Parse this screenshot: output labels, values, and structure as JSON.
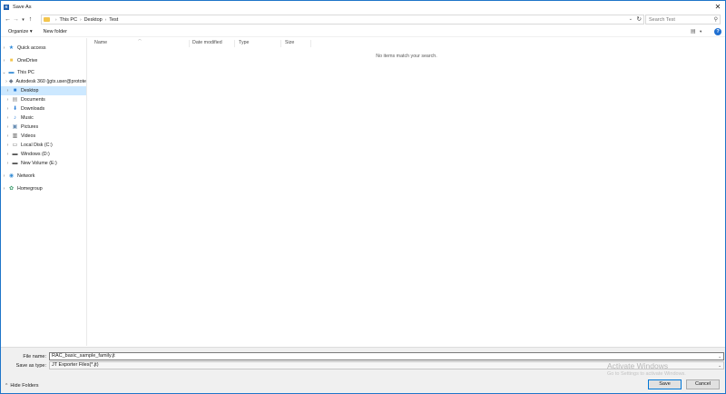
{
  "window": {
    "title": "Save As",
    "app_icon": "R",
    "close_glyph": "✕"
  },
  "address": {
    "breadcrumbs": [
      "This PC",
      "Desktop",
      "Test"
    ],
    "search_placeholder": "Search Test"
  },
  "toolbar": {
    "organize_label": "Organize ▾",
    "new_folder_label": "New folder"
  },
  "nav": {
    "items": [
      {
        "label": "Quick access",
        "icon": "★",
        "icon_name": "quick-access-icon",
        "color": "#2b88d8"
      },
      {
        "label": "OneDrive",
        "icon": "■",
        "icon_name": "onedrive-folder-icon",
        "color": "#f3c54c"
      },
      {
        "label": "This PC",
        "icon": "▬",
        "icon_name": "this-pc-icon",
        "color": "#3a8fd6"
      },
      {
        "label": "Autodesk 360 (jgtx.user@protote",
        "icon": "◆",
        "icon_name": "autodesk-360-icon",
        "color": "#6d7a8c"
      },
      {
        "label": "Desktop",
        "icon": "■",
        "icon_name": "desktop-icon",
        "color": "#2b7fd8"
      },
      {
        "label": "Documents",
        "icon": "▤",
        "icon_name": "documents-icon",
        "color": "#8a8a8a"
      },
      {
        "label": "Downloads",
        "icon": "⬇",
        "icon_name": "downloads-icon",
        "color": "#2b7fd8"
      },
      {
        "label": "Music",
        "icon": "♪",
        "icon_name": "music-icon",
        "color": "#2b7fd8"
      },
      {
        "label": "Pictures",
        "icon": "▣",
        "icon_name": "pictures-icon",
        "color": "#6a8fb5"
      },
      {
        "label": "Videos",
        "icon": "▥",
        "icon_name": "videos-icon",
        "color": "#555555"
      },
      {
        "label": "Local Disk (C:)",
        "icon": "▭",
        "icon_name": "local-disk-icon",
        "color": "#666666"
      },
      {
        "label": "Windows (D:)",
        "icon": "▬",
        "icon_name": "drive-d-icon",
        "color": "#555555"
      },
      {
        "label": "New Volume (E:)",
        "icon": "▬",
        "icon_name": "drive-e-icon",
        "color": "#555555"
      },
      {
        "label": "Network",
        "icon": "◉",
        "icon_name": "network-icon",
        "color": "#3a8fd6"
      },
      {
        "label": "Homegroup",
        "icon": "✿",
        "icon_name": "homegroup-icon",
        "color": "#3a9a6b"
      }
    ]
  },
  "content": {
    "columns": [
      "Name",
      "Date modified",
      "Type",
      "Size"
    ],
    "empty_message": "No items match your search."
  },
  "bottom": {
    "file_name_label": "File name:",
    "file_name_value": "RAC_basic_sample_family.jt",
    "save_type_label": "Save as type:",
    "save_type_value": "JT Exporter Files(*.jt)",
    "hide_folders_label": "Hide Folders",
    "watermark_title": "Activate Windows",
    "watermark_sub": "Go to Settings to activate Windows.",
    "save_label": "Save",
    "cancel_label": "Cancel"
  }
}
